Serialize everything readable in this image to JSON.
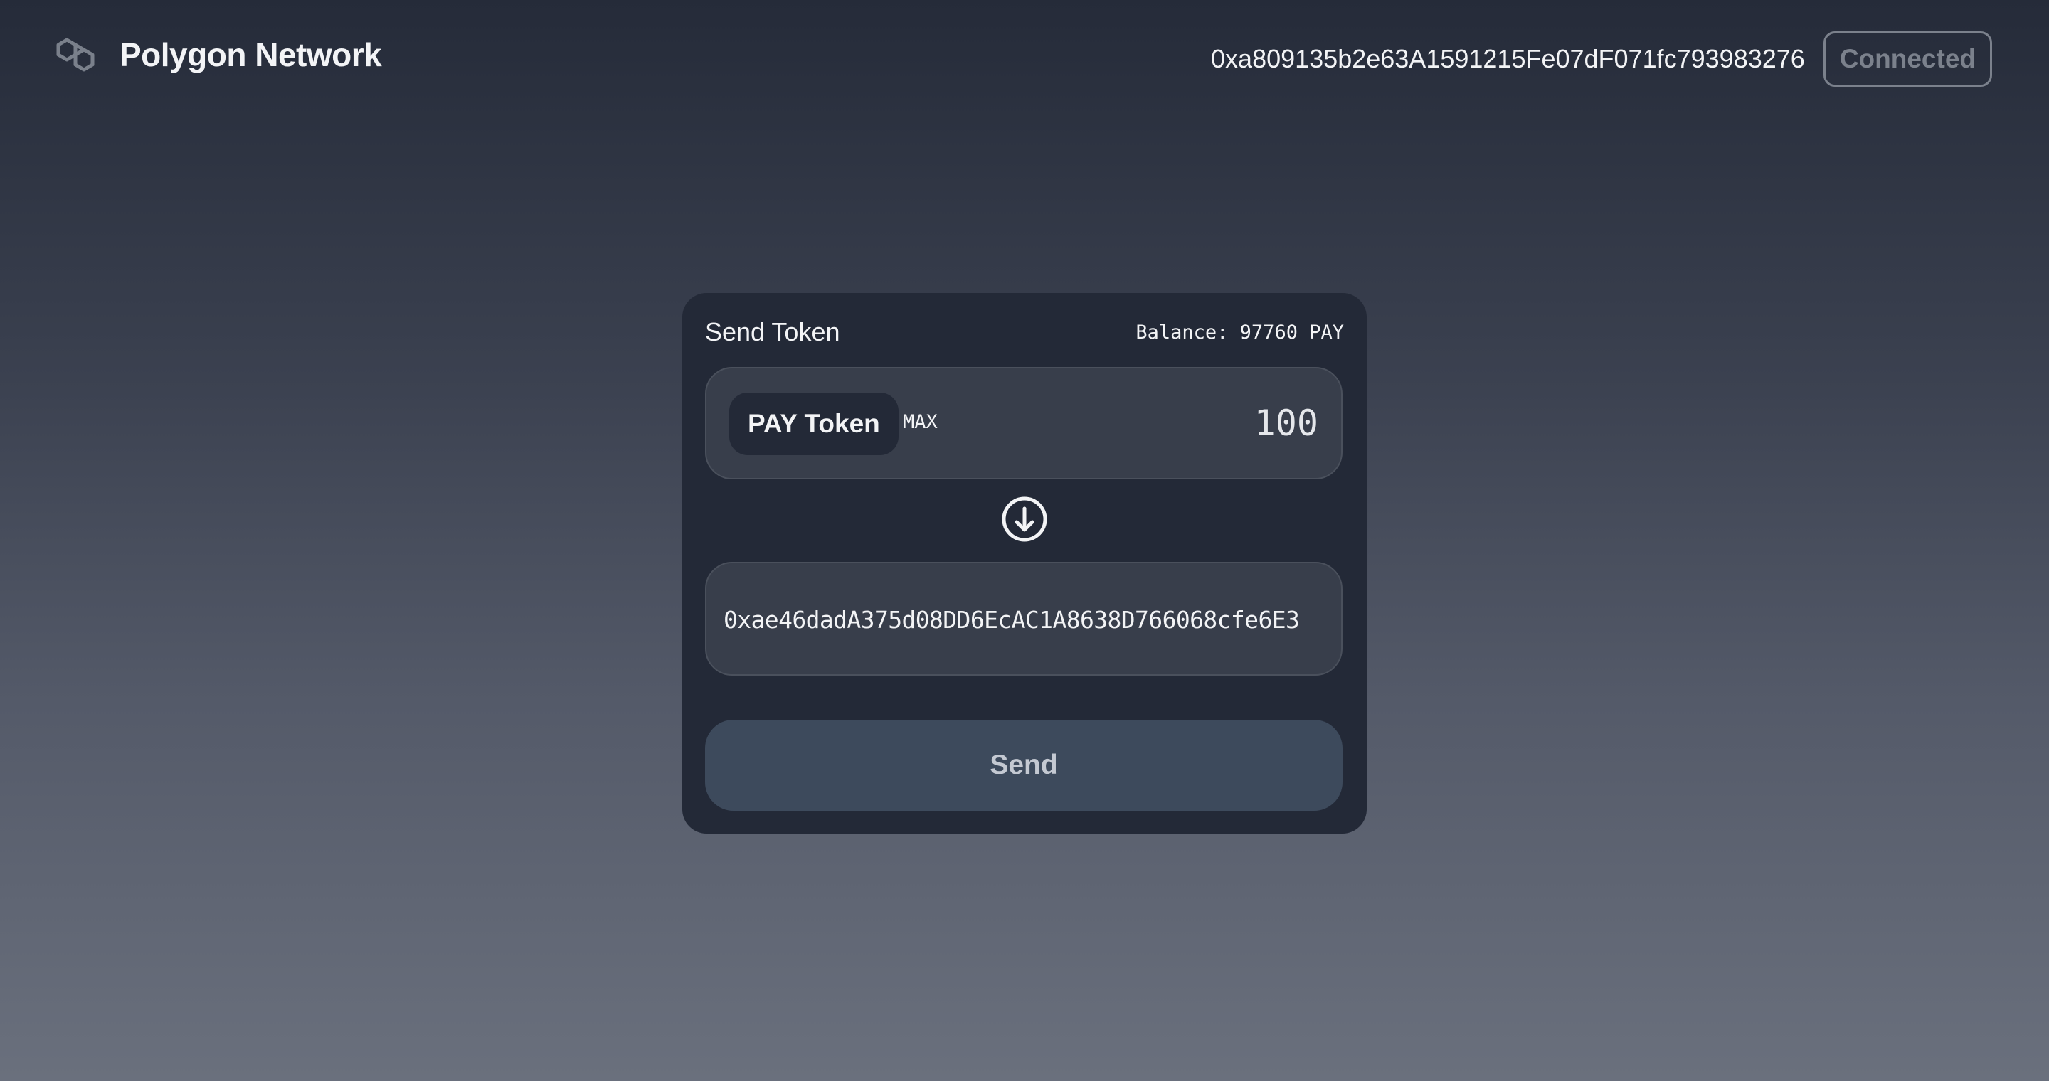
{
  "header": {
    "brand_name": "Polygon Network",
    "brand_icon": "polygon-logo-icon",
    "wallet_address": "0xa809135b2e63A1591215Fe07dF071fc793983276",
    "connection_status": "Connected"
  },
  "send_card": {
    "title": "Send Token",
    "balance_label": "Balance:",
    "balance_value": "97760",
    "balance_unit": "PAY",
    "token_label": "PAY Token",
    "max_label": "MAX",
    "amount_value": "100",
    "arrow_icon": "arrow-down-circle-icon",
    "recipient_address": "0xae46dadA375d08DD6EcAC1A8638D766068cfe6E3",
    "send_label": "Send"
  },
  "colors": {
    "background_top": "#252b39",
    "background_bottom": "#6a707d",
    "card": "#232937",
    "field": "#383e4b",
    "send_button": "#3d4a5c",
    "send_button_text": "#c4c9d2",
    "connected_border": "#7b818c"
  }
}
